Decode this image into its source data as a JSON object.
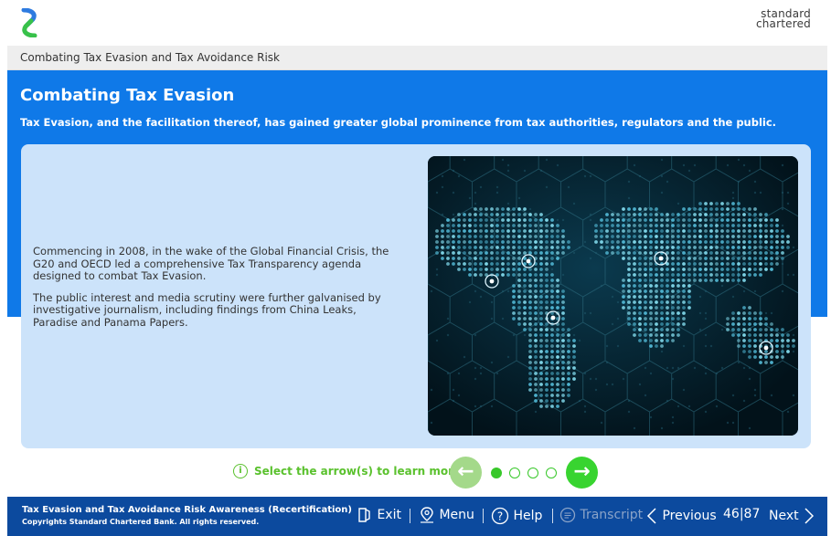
{
  "app": {
    "brand_line1": "standard",
    "brand_line2": "chartered",
    "breadcrumb": "Combating Tax Evasion and Tax Avoidance Risk"
  },
  "slide": {
    "title": "Combating Tax Evasion",
    "subtitle": "Tax Evasion, and the facilitation thereof, has gained greater global prominence from tax authorities, regulators and the public.",
    "paragraphs": [
      "Commencing in 2008, in the wake of the Global Financial Crisis, the G20 and OECD led a comprehensive Tax Transparency agenda designed to combat Tax Evasion.",
      "The public interest and media scrutiny were further galvanised by investigative journalism, including findings from China Leaks, Paradise and Panama Papers."
    ],
    "image_icon": "world-network-image"
  },
  "navigation": {
    "hint": "Select the arrow(s) to learn more.",
    "hint_icon": "info-icon",
    "prev_icon": "arrow-left-icon",
    "next_icon": "arrow-right-icon",
    "steps_total": 4,
    "active_step": 1,
    "colors": {
      "green": "#38d430",
      "green_light": "#a4d98a"
    }
  },
  "footer": {
    "course_title": "Tax Evasion and Tax Avoidance Risk Awareness (Recertification)",
    "copyright": "Copyrights Standard Chartered Bank. All rights reserved.",
    "exit_label": "Exit",
    "menu_label": "Menu",
    "help_label": "Help",
    "transcript_label": "Transcript",
    "previous_label": "Previous",
    "page_current": "46",
    "page_sep": "|",
    "page_total": "87",
    "next_label": "Next",
    "colors": {
      "bar": "#0c4a9e",
      "primary_blue": "#0f79e8"
    }
  }
}
